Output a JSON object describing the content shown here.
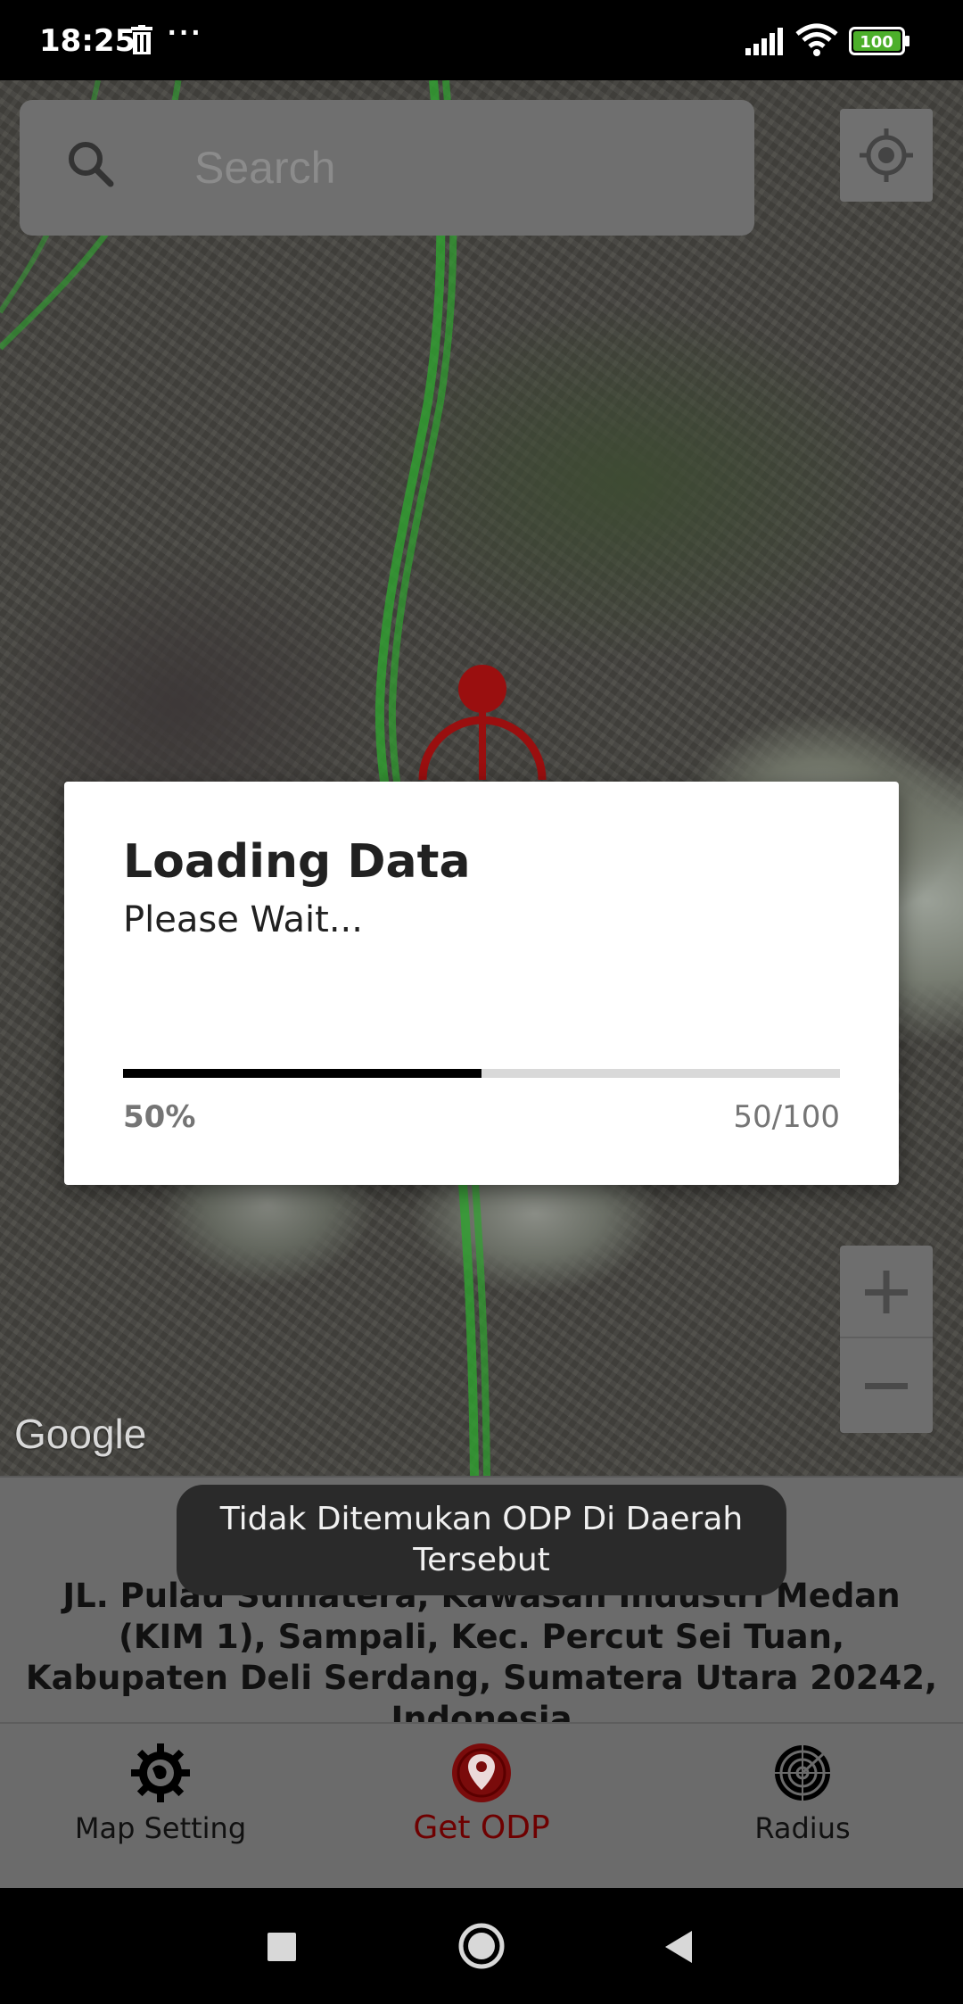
{
  "status_bar": {
    "time": "18:25",
    "more_indicator": "···",
    "battery_level": "100"
  },
  "map": {
    "attribution": "Google",
    "search": {
      "placeholder": "Search"
    },
    "zoom_in_label": "+",
    "zoom_out_label": "−"
  },
  "dialog": {
    "title": "Loading Data",
    "message": "Please Wait...",
    "progress_fraction": 0.5,
    "progress_percent": "50%",
    "progress_count": "50/100"
  },
  "toast": {
    "text": "Tidak Ditemukan ODP Di Daerah Tersebut"
  },
  "address": {
    "text": "JL. Pulau Sumatera, Kawasan Industri Medan (KIM 1), Sampali, Kec. Percut Sei Tuan, Kabupaten Deli Serdang, Sumatera Utara 20242, Indonesia"
  },
  "bottom_nav": {
    "items": [
      {
        "label": "Map Setting",
        "icon": "gear-globe-icon"
      },
      {
        "label": "Get ODP",
        "icon": "location-pin-icon",
        "active": true
      },
      {
        "label": "Radius",
        "icon": "radar-icon"
      }
    ]
  },
  "colors": {
    "accent": "#8b0000",
    "route": "#3bbf3b",
    "marker": "#b30000"
  }
}
